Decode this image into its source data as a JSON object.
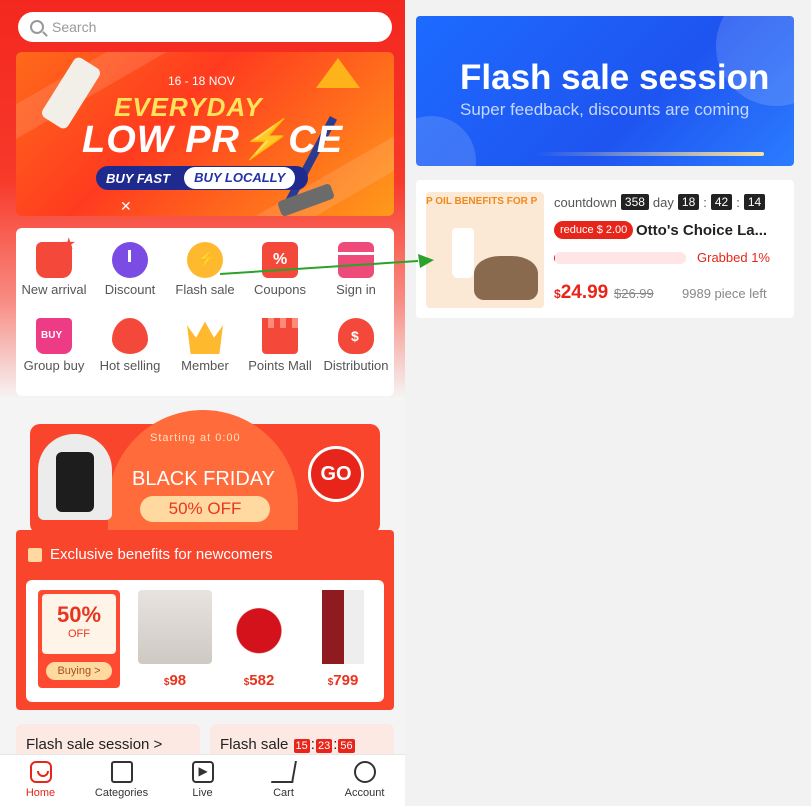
{
  "search": {
    "placeholder": "Search"
  },
  "banner": {
    "date": "16 - 18 NOV",
    "line1": "EVERYDAY",
    "line2": "LOW PR⚡CE",
    "buy_fast": "BUY FAST",
    "buy_locally": "BUY LOCALLY"
  },
  "quick_links": [
    {
      "label": "New arrival",
      "icon": "new-arrival-icon"
    },
    {
      "label": "Discount",
      "icon": "discount-icon"
    },
    {
      "label": "Flash sale",
      "icon": "flash-sale-icon"
    },
    {
      "label": "Coupons",
      "icon": "coupons-icon"
    },
    {
      "label": "Sign in",
      "icon": "sign-in-icon"
    },
    {
      "label": "Group buy",
      "icon": "group-buy-icon"
    },
    {
      "label": "Hot selling",
      "icon": "hot-selling-icon"
    },
    {
      "label": "Member",
      "icon": "member-icon"
    },
    {
      "label": "Points Mall",
      "icon": "points-mall-icon"
    },
    {
      "label": "Distribution",
      "icon": "distribution-icon"
    }
  ],
  "black_friday": {
    "starting": "Starting at 0:00",
    "title": "BLACK FRIDAY",
    "off": "50% OFF",
    "go": "GO",
    "exclusive": "Exclusive benefits for newcomers",
    "coupon_pct": "50%",
    "coupon_off": "OFF",
    "coupon_buy": "Buying >",
    "products": [
      {
        "currency": "$",
        "price": "98"
      },
      {
        "currency": "$",
        "price": "582"
      },
      {
        "currency": "$",
        "price": "799"
      }
    ]
  },
  "bottom_cards": {
    "session": "Flash sale session >",
    "flash": "Flash sale",
    "timer": [
      "15",
      "23",
      "56"
    ]
  },
  "tabbar": [
    {
      "label": "Home",
      "icon": "home-icon"
    },
    {
      "label": "Categories",
      "icon": "categories-icon"
    },
    {
      "label": "Live",
      "icon": "live-icon"
    },
    {
      "label": "Cart",
      "icon": "cart-icon"
    },
    {
      "label": "Account",
      "icon": "account-icon"
    }
  ],
  "hero": {
    "title": "Flash sale session",
    "subtitle": "Super feedback, discounts are coming"
  },
  "deal": {
    "image_tag": "P OIL BENEFITS FOR P",
    "countdown_label": "countdown",
    "days": "358",
    "day_label": "day",
    "hours": "18",
    "minutes": "42",
    "seconds": "14",
    "reduce": "reduce $ 2.00",
    "title": "Otto's Choice La...",
    "grabbed": "Grabbed 1%",
    "grabbed_pct": 1,
    "currency": "$",
    "price": "24.99",
    "old_price": "$26.99",
    "stock": "9989  piece left"
  },
  "colors": {
    "brand_red": "#e8251a",
    "hero_blue": "#1e54f0",
    "arrow_green": "#2aa32a"
  }
}
